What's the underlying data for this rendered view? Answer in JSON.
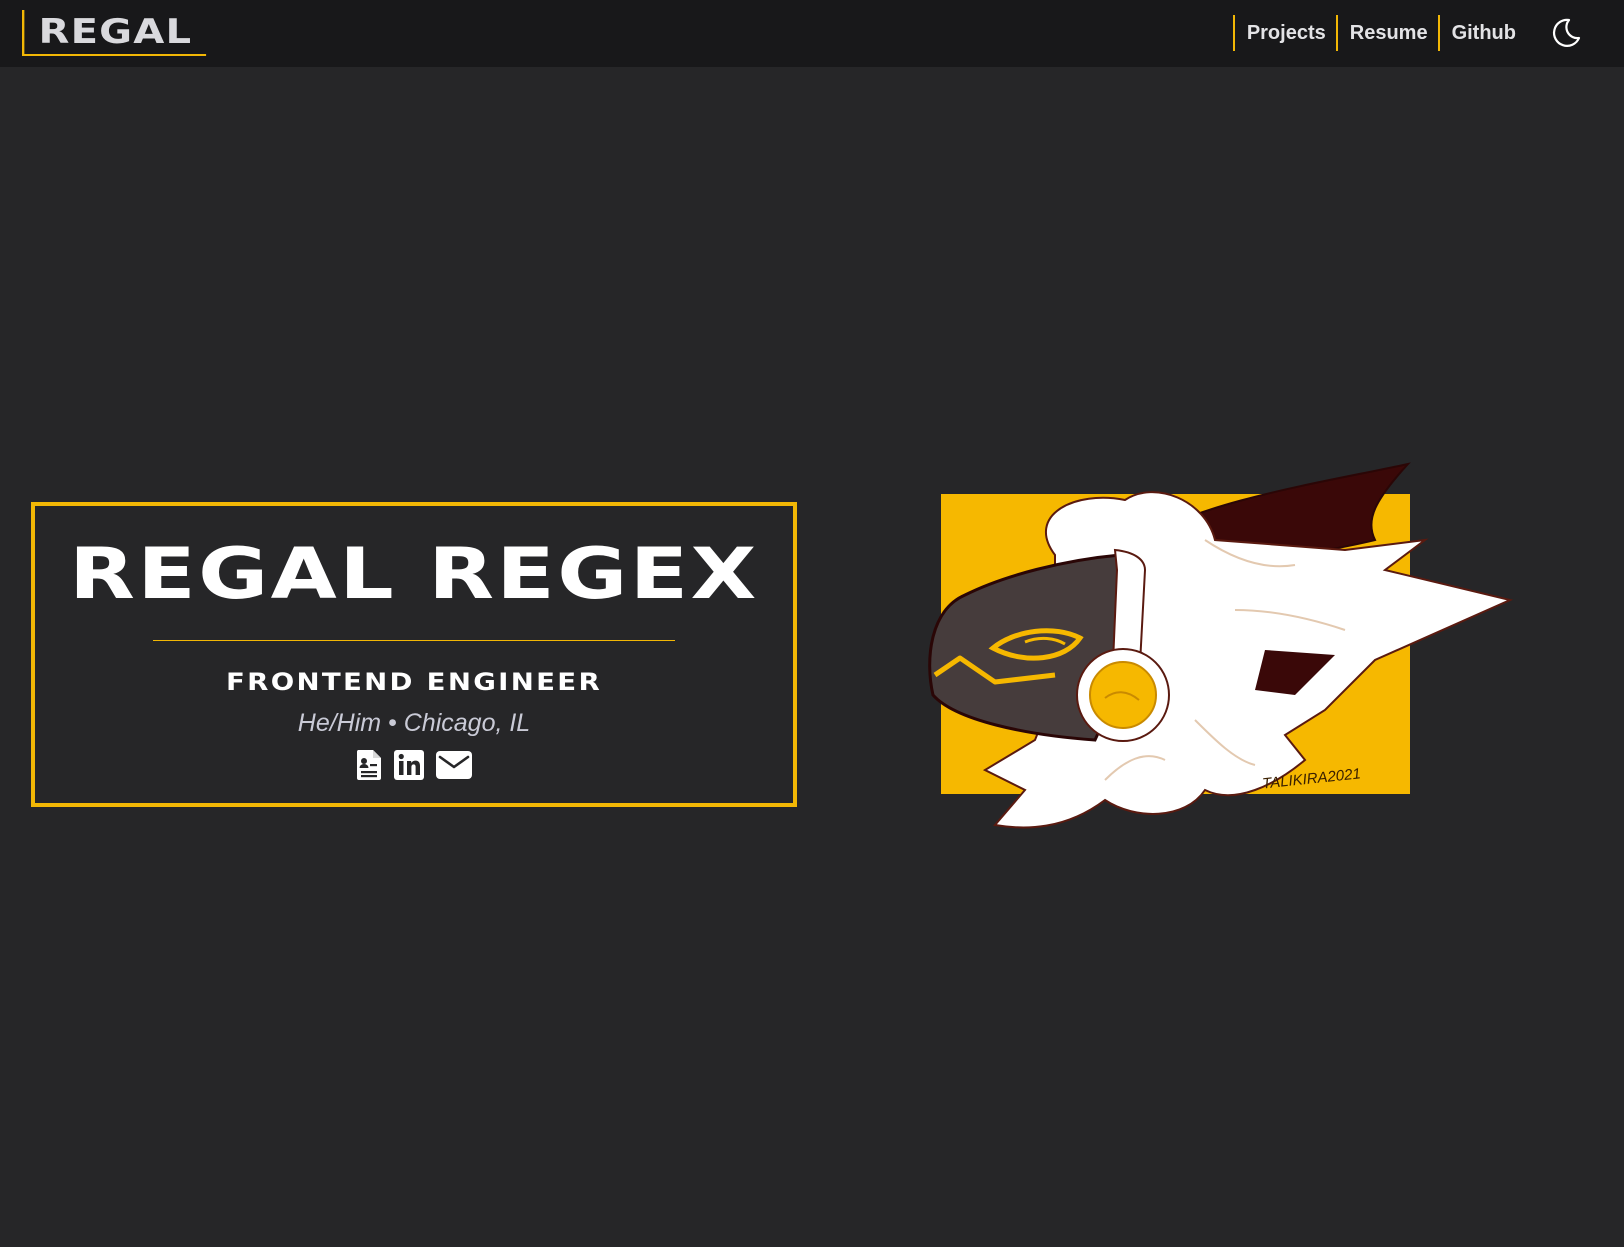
{
  "nav": {
    "brand": "REGAL",
    "links": [
      {
        "label": "Projects"
      },
      {
        "label": "Resume"
      },
      {
        "label": "Github"
      }
    ],
    "theme_toggle_icon": "moon-icon"
  },
  "hero": {
    "title": "REGAL REGEX",
    "subtitle": "FRONTEND ENGINEER",
    "meta": "He/Him • Chicago, IL",
    "icons": [
      "resume-icon",
      "linkedin-icon",
      "email-icon"
    ]
  },
  "mascot": {
    "signature": "TALIKIRA2021"
  },
  "colors": {
    "accent": "#f2b705",
    "background": "#262628",
    "navbar": "#18181a",
    "text": "#ffffff"
  }
}
